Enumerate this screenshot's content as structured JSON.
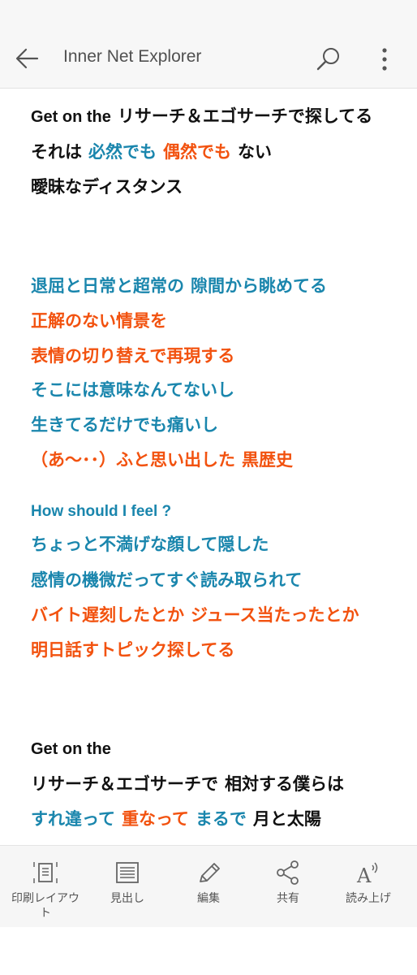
{
  "header": {
    "title": "Inner Net Explorer",
    "back_icon": "arrow-left-icon",
    "search_icon": "search-icon",
    "more_icon": "more-vertical-icon"
  },
  "colors": {
    "black": "#111111",
    "blue": "#1a86ad",
    "orange": "#f2520f"
  },
  "lyrics": [
    [
      {
        "t": "Get on the",
        "c": "black"
      },
      {
        "t": "リサーチ＆エゴサーチで探してる",
        "c": "black"
      }
    ],
    [
      {
        "t": "それは",
        "c": "black"
      },
      {
        "t": "必然でも",
        "c": "blue"
      },
      {
        "t": "偶然でも",
        "c": "orange"
      },
      {
        "t": "ない",
        "c": "black"
      }
    ],
    [
      {
        "t": "曖昧なディスタンス",
        "c": "black"
      }
    ],
    [
      {
        "t": "退屈と日常と超常の",
        "c": "blue"
      },
      {
        "t": "隙間から眺めてる",
        "c": "blue"
      }
    ],
    [
      {
        "t": "正解のない情景を",
        "c": "orange"
      }
    ],
    [
      {
        "t": "表情の切り替えで再現する",
        "c": "orange"
      }
    ],
    [
      {
        "t": "そこには意味なんてないし",
        "c": "blue"
      }
    ],
    [
      {
        "t": "生きてるだけでも痛いし",
        "c": "blue"
      }
    ],
    [
      {
        "t": "（あ～･･）ふと思い出した",
        "c": "orange"
      },
      {
        "t": "黒歴史",
        "c": "orange"
      }
    ],
    [
      {
        "t": "How should I feel ?",
        "c": "blue"
      }
    ],
    [
      {
        "t": "ちょっと不満げな顔して隠した",
        "c": "blue"
      }
    ],
    [
      {
        "t": "感情の機微だってすぐ読み取られて",
        "c": "blue"
      }
    ],
    [
      {
        "t": "バイト遅刻したとか",
        "c": "orange"
      },
      {
        "t": "ジュース当たったとか",
        "c": "orange"
      }
    ],
    [
      {
        "t": "明日話すトピック探してる",
        "c": "orange"
      }
    ],
    [
      {
        "t": "Get on the",
        "c": "black"
      }
    ],
    [
      {
        "t": "リサーチ＆エゴサーチで",
        "c": "black"
      },
      {
        "t": "相対する僕らは",
        "c": "black"
      }
    ],
    [
      {
        "t": "すれ違って",
        "c": "blue"
      },
      {
        "t": "重なって",
        "c": "orange"
      },
      {
        "t": "まるで",
        "c": "blue"
      },
      {
        "t": "月と太陽",
        "c": "black"
      }
    ]
  ],
  "toolbar": {
    "items": [
      {
        "label": "印刷レイアウト",
        "icon": "print-layout-icon"
      },
      {
        "label": "見出し",
        "icon": "headings-icon"
      },
      {
        "label": "編集",
        "icon": "pencil-icon"
      },
      {
        "label": "共有",
        "icon": "share-icon"
      },
      {
        "label": "読み上げ",
        "icon": "read-aloud-icon"
      }
    ]
  }
}
